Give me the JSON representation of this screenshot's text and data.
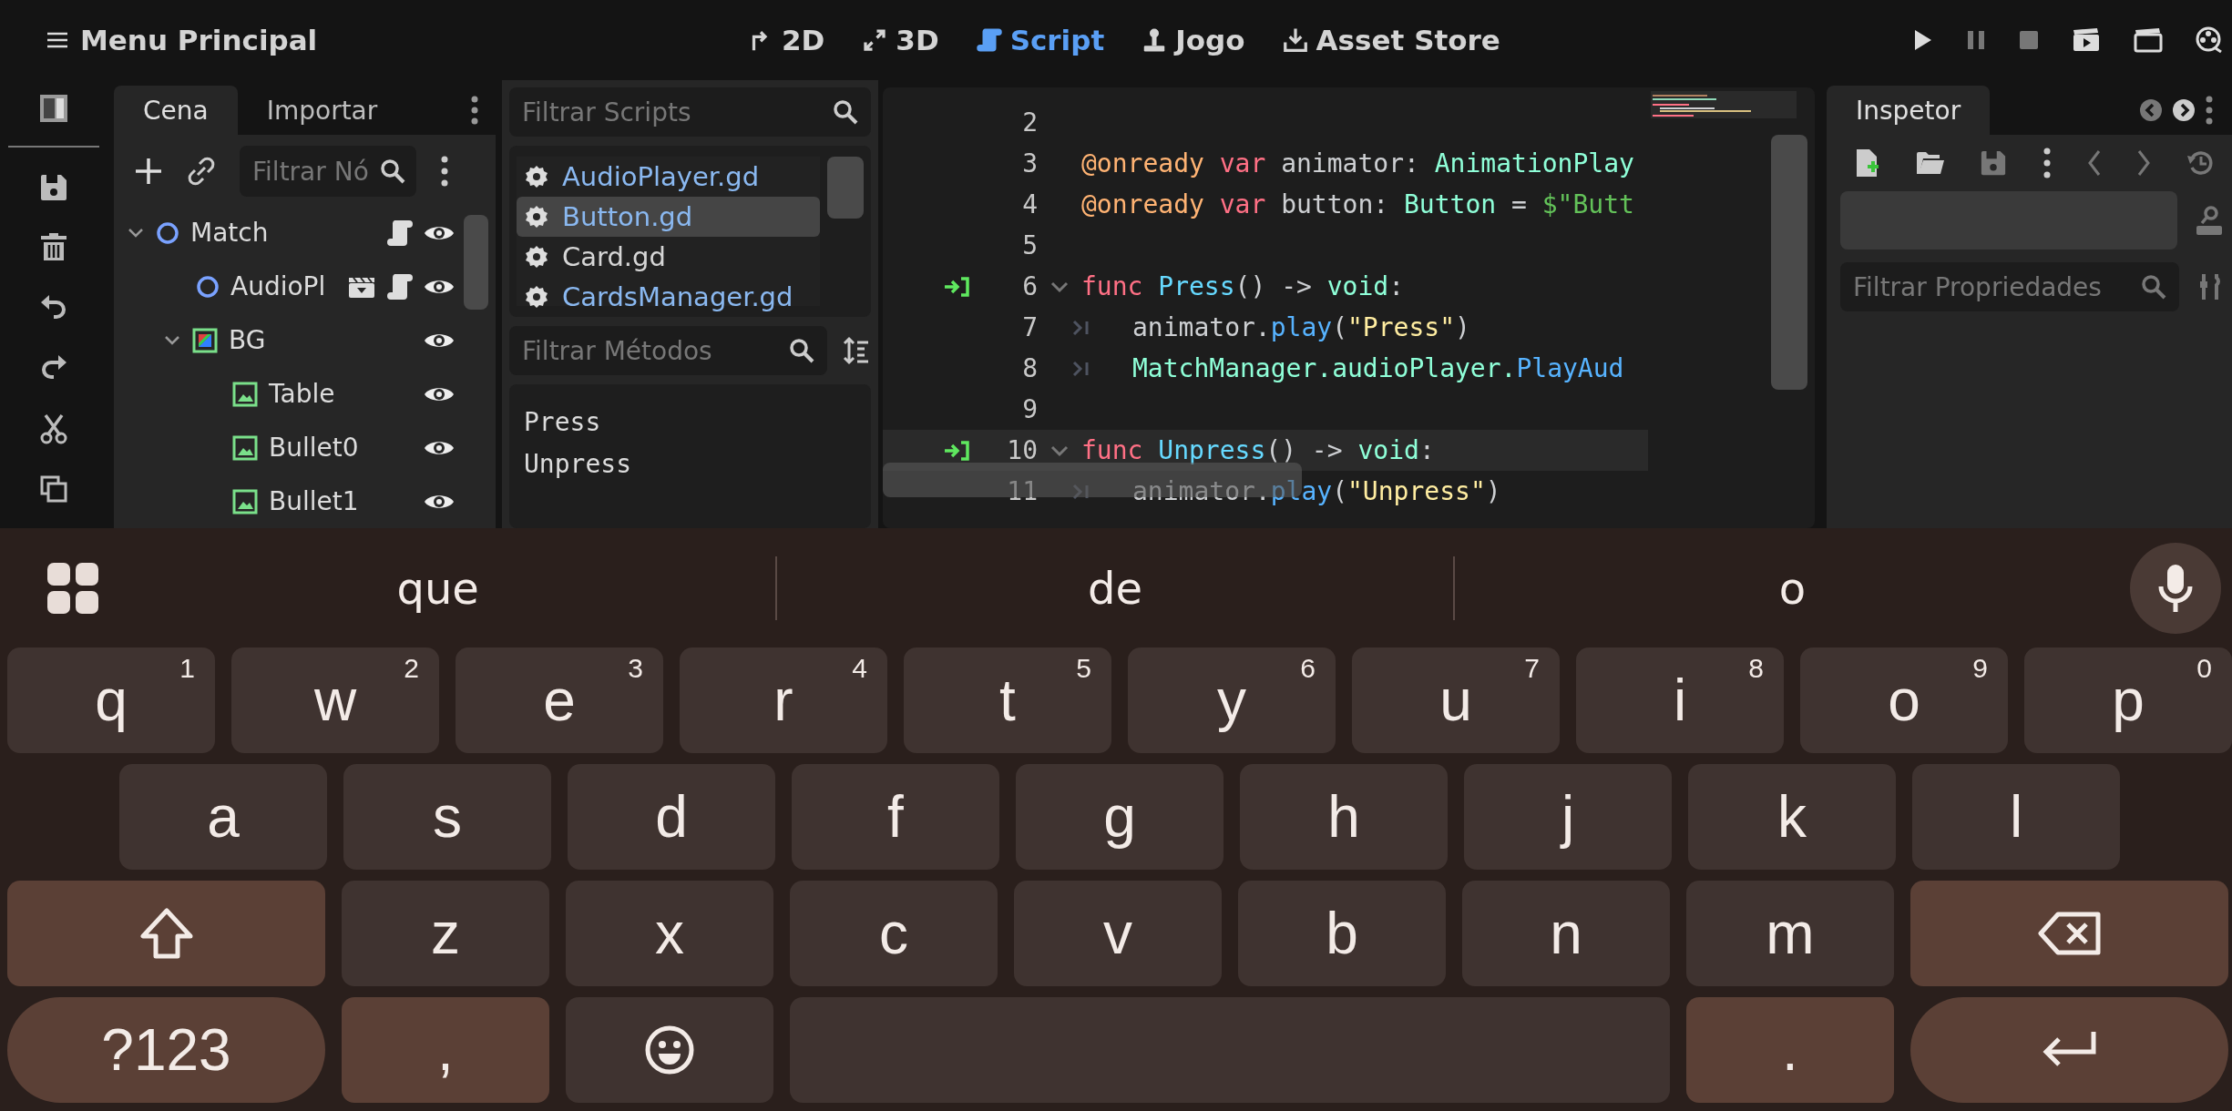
{
  "top_bar": {
    "menu_title": "Menu Principal",
    "workspaces": [
      {
        "label": "2D",
        "kind": "canvas",
        "selected": false
      },
      {
        "label": "3D",
        "kind": "spatial",
        "selected": false
      },
      {
        "label": "Script",
        "kind": "script",
        "selected": true
      },
      {
        "label": "Jogo",
        "kind": "game",
        "selected": false
      },
      {
        "label": "Asset Store",
        "kind": "assets",
        "selected": false
      }
    ]
  },
  "scene_dock": {
    "tabs": [
      {
        "label": "Cena",
        "selected": true
      },
      {
        "label": "Importar",
        "selected": false
      }
    ],
    "filter": {
      "placeholder": "Filtrar Nó"
    },
    "tree": [
      {
        "name": "Match",
        "kind": "node",
        "expanded": true,
        "has_animation": false,
        "has_script": true,
        "visible": true,
        "children": [
          {
            "name": "AudioPl",
            "kind": "node",
            "has_animation": true,
            "has_script": true,
            "visible": true
          },
          {
            "name": "BG",
            "kind": "colorrect",
            "expanded": true,
            "has_animation": false,
            "has_script": false,
            "visible": true,
            "children": [
              {
                "name": "Table",
                "kind": "sprite",
                "has_animation": false,
                "has_script": false,
                "visible": true
              },
              {
                "name": "Bullet0",
                "kind": "sprite",
                "has_animation": false,
                "has_script": false,
                "visible": true
              },
              {
                "name": "Bullet1",
                "kind": "sprite",
                "has_animation": false,
                "has_script": false,
                "visible": true
              }
            ]
          }
        ]
      }
    ]
  },
  "script_panel": {
    "filter": {
      "placeholder": "Filtrar Scripts"
    },
    "scripts": [
      {
        "name": "AudioPlayer.gd",
        "color": "#8ab8f0",
        "selected": false
      },
      {
        "name": "Button.gd",
        "color": "#8ab8f0",
        "selected": true
      },
      {
        "name": "Card.gd",
        "color": "#d6d6d6",
        "selected": false
      },
      {
        "name": "CardsManager.gd",
        "color": "#8ab8f0",
        "selected": false
      }
    ],
    "method_filter": {
      "placeholder": "Filtrar Métodos"
    },
    "methods": [
      "Press",
      "Unpress"
    ]
  },
  "code": {
    "lines": [
      {
        "number": "2"
      },
      {
        "number": "3",
        "tokens": [
          {
            "kind": "annotation",
            "text": "@onready"
          },
          {
            "kind": "keyword",
            "text": " var"
          },
          {
            "kind": "ident",
            "text": " animator: "
          },
          {
            "kind": "type",
            "text": "AnimationPlay"
          }
        ]
      },
      {
        "number": "4",
        "tokens": [
          {
            "kind": "annotation",
            "text": "@onready"
          },
          {
            "kind": "keyword",
            "text": " var"
          },
          {
            "kind": "ident",
            "text": " button: "
          },
          {
            "kind": "type",
            "text": "Button"
          },
          {
            "kind": "ident",
            "text": " = "
          },
          {
            "kind": "nodepath",
            "text": "$\"Butt"
          }
        ]
      },
      {
        "number": "5"
      },
      {
        "number": "6",
        "connected": true,
        "foldable": true,
        "tokens": [
          {
            "kind": "keyword",
            "text": "func"
          },
          {
            "kind": "funcname",
            "text": " Press"
          },
          {
            "kind": "ident",
            "text": "() -> "
          },
          {
            "kind": "type",
            "text": "void"
          },
          {
            "kind": "ident",
            "text": ":"
          }
        ]
      },
      {
        "number": "7",
        "tab": true,
        "tokens": [
          {
            "kind": "ident",
            "text": "animator."
          },
          {
            "kind": "method",
            "text": "play"
          },
          {
            "kind": "ident",
            "text": "("
          },
          {
            "kind": "string",
            "text": "\"Press\""
          },
          {
            "kind": "ident",
            "text": ")"
          }
        ]
      },
      {
        "number": "8",
        "tab": true,
        "tokens": [
          {
            "kind": "type",
            "text": "MatchManager.audioPlayer."
          },
          {
            "kind": "method",
            "text": "PlayAud"
          }
        ]
      },
      {
        "number": "9"
      },
      {
        "number": "10",
        "connected": true,
        "foldable": true,
        "current": true,
        "tokens": [
          {
            "kind": "keyword",
            "text": "func"
          },
          {
            "kind": "funcname",
            "text": " Unpress"
          },
          {
            "kind": "ident",
            "text": "() -> "
          },
          {
            "kind": "type",
            "text": "void"
          },
          {
            "kind": "ident",
            "text": ":"
          }
        ]
      },
      {
        "number": "11",
        "tab": true,
        "tokens": [
          {
            "kind": "ident",
            "text": "animator."
          },
          {
            "kind": "method",
            "text": "play"
          },
          {
            "kind": "ident",
            "text": "("
          },
          {
            "kind": "string",
            "text": "\"Unpress\""
          },
          {
            "kind": "ident",
            "text": ")"
          }
        ]
      }
    ]
  },
  "inspector": {
    "tabs": [
      {
        "label": "Inspetor",
        "selected": true
      }
    ],
    "filter": {
      "placeholder": "Filtrar Propriedades"
    }
  },
  "keyboard": {
    "suggestions": [
      "que",
      "de",
      "o"
    ],
    "key_rows": [
      {
        "keys": [
          {
            "kind": "letter",
            "label": "q",
            "hint": "1"
          },
          {
            "kind": "letter",
            "label": "w",
            "hint": "2"
          },
          {
            "kind": "letter",
            "label": "e",
            "hint": "3"
          },
          {
            "kind": "letter",
            "label": "r",
            "hint": "4"
          },
          {
            "kind": "letter",
            "label": "t",
            "hint": "5"
          },
          {
            "kind": "letter",
            "label": "y",
            "hint": "6"
          },
          {
            "kind": "letter",
            "label": "u",
            "hint": "7"
          },
          {
            "kind": "letter",
            "label": "i",
            "hint": "8"
          },
          {
            "kind": "letter",
            "label": "o",
            "hint": "9"
          },
          {
            "kind": "letter",
            "label": "p",
            "hint": "0"
          }
        ]
      },
      {
        "keys": [
          {
            "kind": "letter",
            "label": "a"
          },
          {
            "kind": "letter",
            "label": "s"
          },
          {
            "kind": "letter",
            "label": "d"
          },
          {
            "kind": "letter",
            "label": "f"
          },
          {
            "kind": "letter",
            "label": "g"
          },
          {
            "kind": "letter",
            "label": "h"
          },
          {
            "kind": "letter",
            "label": "j"
          },
          {
            "kind": "letter",
            "label": "k"
          },
          {
            "kind": "letter",
            "label": "l"
          }
        ]
      },
      {
        "keys": [
          {
            "kind": "shift"
          },
          {
            "kind": "letter",
            "label": "z"
          },
          {
            "kind": "letter",
            "label": "x"
          },
          {
            "kind": "letter",
            "label": "c"
          },
          {
            "kind": "letter",
            "label": "v"
          },
          {
            "kind": "letter",
            "label": "b"
          },
          {
            "kind": "letter",
            "label": "n"
          },
          {
            "kind": "letter",
            "label": "m"
          },
          {
            "kind": "backspace"
          }
        ]
      },
      {
        "keys": [
          {
            "kind": "symbols",
            "label": "?123"
          },
          {
            "kind": "punct",
            "label": ","
          },
          {
            "kind": "emoji"
          },
          {
            "kind": "space"
          },
          {
            "kind": "punct",
            "label": "."
          },
          {
            "kind": "enter"
          }
        ]
      }
    ]
  }
}
